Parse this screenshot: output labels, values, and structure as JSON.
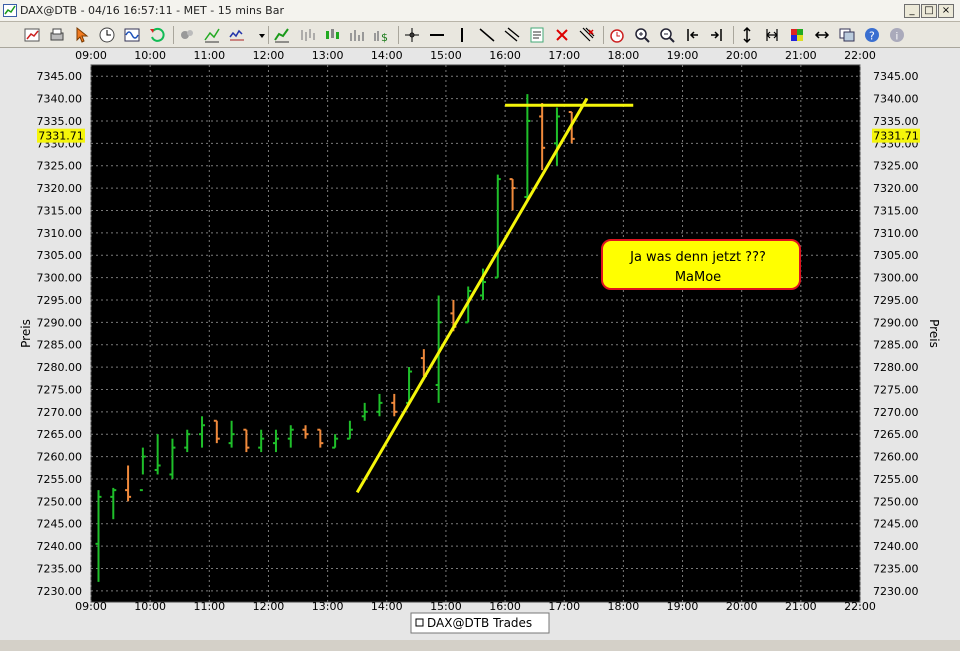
{
  "window": {
    "title": "DAX@DTB - 04/16 16:57:11  - MET - 15 mins Bar",
    "btn_minimize": "_",
    "btn_maximize": "□",
    "btn_close": "×"
  },
  "toolbar": {
    "icons": [
      "new-chart-icon",
      "print-icon",
      "cursor-icon",
      "clock-icon",
      "wave-icon",
      "refresh-icon",
      "save-icon",
      "indicator-icon",
      "zoom-chart-icon",
      "dropdown-icon",
      "line-chart-icon",
      "bar-chart-icon",
      "candle-chart-icon",
      "volume-chart-icon",
      "dollar-chart-icon",
      "crosshair-icon",
      "horizontal-line-icon",
      "vertical-line-icon",
      "trendline-icon",
      "channel-icon",
      "text-icon",
      "delete-icon",
      "multi-delete-icon",
      "alarm-icon",
      "zoom-in-icon",
      "zoom-out-icon",
      "scroll-left-icon",
      "scroll-right-icon",
      "compress-icon",
      "expand-icon",
      "colors-icon",
      "link-icon",
      "window-icon",
      "help-icon",
      "info-icon"
    ]
  },
  "colors": {
    "up_bar": "#1fbf2a",
    "down_bar": "#f08a3c",
    "trendline": "#f5f50a",
    "plot_bg": "#000000",
    "grid": "#7a7a7a",
    "price_tag_bg": "#f5f50a",
    "annotation_border": "#e0141e",
    "annotation_bg": "#ffff00"
  },
  "chart_data": {
    "type": "ohlc",
    "title": "DAX@DTB - 04/16 16:57:11  - MET - 15 mins Bar",
    "ylabel": "Preis",
    "ylim": [
      7227.5,
      7347.5
    ],
    "xlim": [
      "09:00",
      "22:00"
    ],
    "y_ticks": [
      "7230.00",
      "7235.00",
      "7240.00",
      "7245.00",
      "7250.00",
      "7255.00",
      "7260.00",
      "7265.00",
      "7270.00",
      "7275.00",
      "7280.00",
      "7285.00",
      "7290.00",
      "7295.00",
      "7300.00",
      "7305.00",
      "7310.00",
      "7315.00",
      "7320.00",
      "7325.00",
      "7330.00",
      "7335.00",
      "7340.00",
      "7345.00"
    ],
    "x_ticks": [
      "09:00",
      "10:00",
      "11:00",
      "12:00",
      "13:00",
      "14:00",
      "15:00",
      "16:00",
      "17:00",
      "18:00",
      "19:00",
      "20:00",
      "21:00",
      "22:00"
    ],
    "last_price": "7331.71",
    "legend": "DAX@DTB Trades",
    "grid": true,
    "bars": [
      {
        "t": "09:00",
        "o": 7240.5,
        "h": 7252.5,
        "l": 7232,
        "c": 7251
      },
      {
        "t": "09:15",
        "o": 7251,
        "h": 7253,
        "l": 7246,
        "c": 7252.5
      },
      {
        "t": "09:30",
        "o": 7252.5,
        "h": 7258,
        "l": 7250,
        "c": 7251
      },
      {
        "t": "09:45",
        "o": 7252.5,
        "h": 7262,
        "l": 7256,
        "c": 7260
      },
      {
        "t": "10:00",
        "o": 7257,
        "h": 7265,
        "l": 7256,
        "c": 7258
      },
      {
        "t": "10:15",
        "o": 7256,
        "h": 7264,
        "l": 7255,
        "c": 7262
      },
      {
        "t": "10:30",
        "o": 7262,
        "h": 7266,
        "l": 7261,
        "c": 7265
      },
      {
        "t": "10:45",
        "o": 7265,
        "h": 7269,
        "l": 7262,
        "c": 7267
      },
      {
        "t": "11:00",
        "o": 7268,
        "h": 7268,
        "l": 7263,
        "c": 7264
      },
      {
        "t": "11:15",
        "o": 7263,
        "h": 7268,
        "l": 7262,
        "c": 7265
      },
      {
        "t": "11:30",
        "o": 7266,
        "h": 7266,
        "l": 7261,
        "c": 7262
      },
      {
        "t": "11:45",
        "o": 7262,
        "h": 7266,
        "l": 7261,
        "c": 7264
      },
      {
        "t": "12:00",
        "o": 7263,
        "h": 7266,
        "l": 7261,
        "c": 7264
      },
      {
        "t": "12:15",
        "o": 7264,
        "h": 7267,
        "l": 7262,
        "c": 7266
      },
      {
        "t": "12:30",
        "o": 7266,
        "h": 7267,
        "l": 7264,
        "c": 7265
      },
      {
        "t": "12:45",
        "o": 7266,
        "h": 7266,
        "l": 7262,
        "c": 7263
      },
      {
        "t": "13:00",
        "o": 7262,
        "h": 7265,
        "l": 7262,
        "c": 7264
      },
      {
        "t": "13:15",
        "o": 7264,
        "h": 7268,
        "l": 7264,
        "c": 7266
      },
      {
        "t": "13:30",
        "o": 7269,
        "h": 7272,
        "l": 7268,
        "c": 7270
      },
      {
        "t": "13:45",
        "o": 7270,
        "h": 7274,
        "l": 7269,
        "c": 7272
      },
      {
        "t": "14:00",
        "o": 7272,
        "h": 7274,
        "l": 7269,
        "c": 7270
      },
      {
        "t": "14:15",
        "o": 7272,
        "h": 7280,
        "l": 7272,
        "c": 7279
      },
      {
        "t": "14:30",
        "o": 7282,
        "h": 7284,
        "l": 7278,
        "c": 7278
      },
      {
        "t": "14:45",
        "o": 7276,
        "h": 7296,
        "l": 7272,
        "c": 7290
      },
      {
        "t": "15:00",
        "o": 7292,
        "h": 7295,
        "l": 7288,
        "c": 7289
      },
      {
        "t": "15:15",
        "o": 7290,
        "h": 7298,
        "l": 7290,
        "c": 7297
      },
      {
        "t": "15:30",
        "o": 7296,
        "h": 7302,
        "l": 7295,
        "c": 7299
      },
      {
        "t": "15:45",
        "o": 7300,
        "h": 7323,
        "l": 7300,
        "c": 7322
      },
      {
        "t": "16:00",
        "o": 7322,
        "h": 7322,
        "l": 7315,
        "c": 7320
      },
      {
        "t": "16:15",
        "o": 7318,
        "h": 7341,
        "l": 7317,
        "c": 7335
      },
      {
        "t": "16:30",
        "o": 7336,
        "h": 7339,
        "l": 7324,
        "c": 7329
      },
      {
        "t": "16:45",
        "o": 7330,
        "h": 7338,
        "l": 7325,
        "c": 7336
      },
      {
        "t": "17:00",
        "o": 7337,
        "h": 7337,
        "l": 7330,
        "c": 7331
      }
    ],
    "drawings": [
      {
        "type": "trendline",
        "from": {
          "t": "13:30",
          "p": 7252
        },
        "to": {
          "t": "17:23",
          "p": 7340
        }
      },
      {
        "type": "horizontal",
        "from": {
          "t": "16:00",
          "p": 7338.5
        },
        "to": {
          "t": "18:10",
          "p": 7338.5
        }
      }
    ],
    "annotation": {
      "line1": "Ja was denn jetzt ???",
      "line2": "MaMoe"
    }
  }
}
